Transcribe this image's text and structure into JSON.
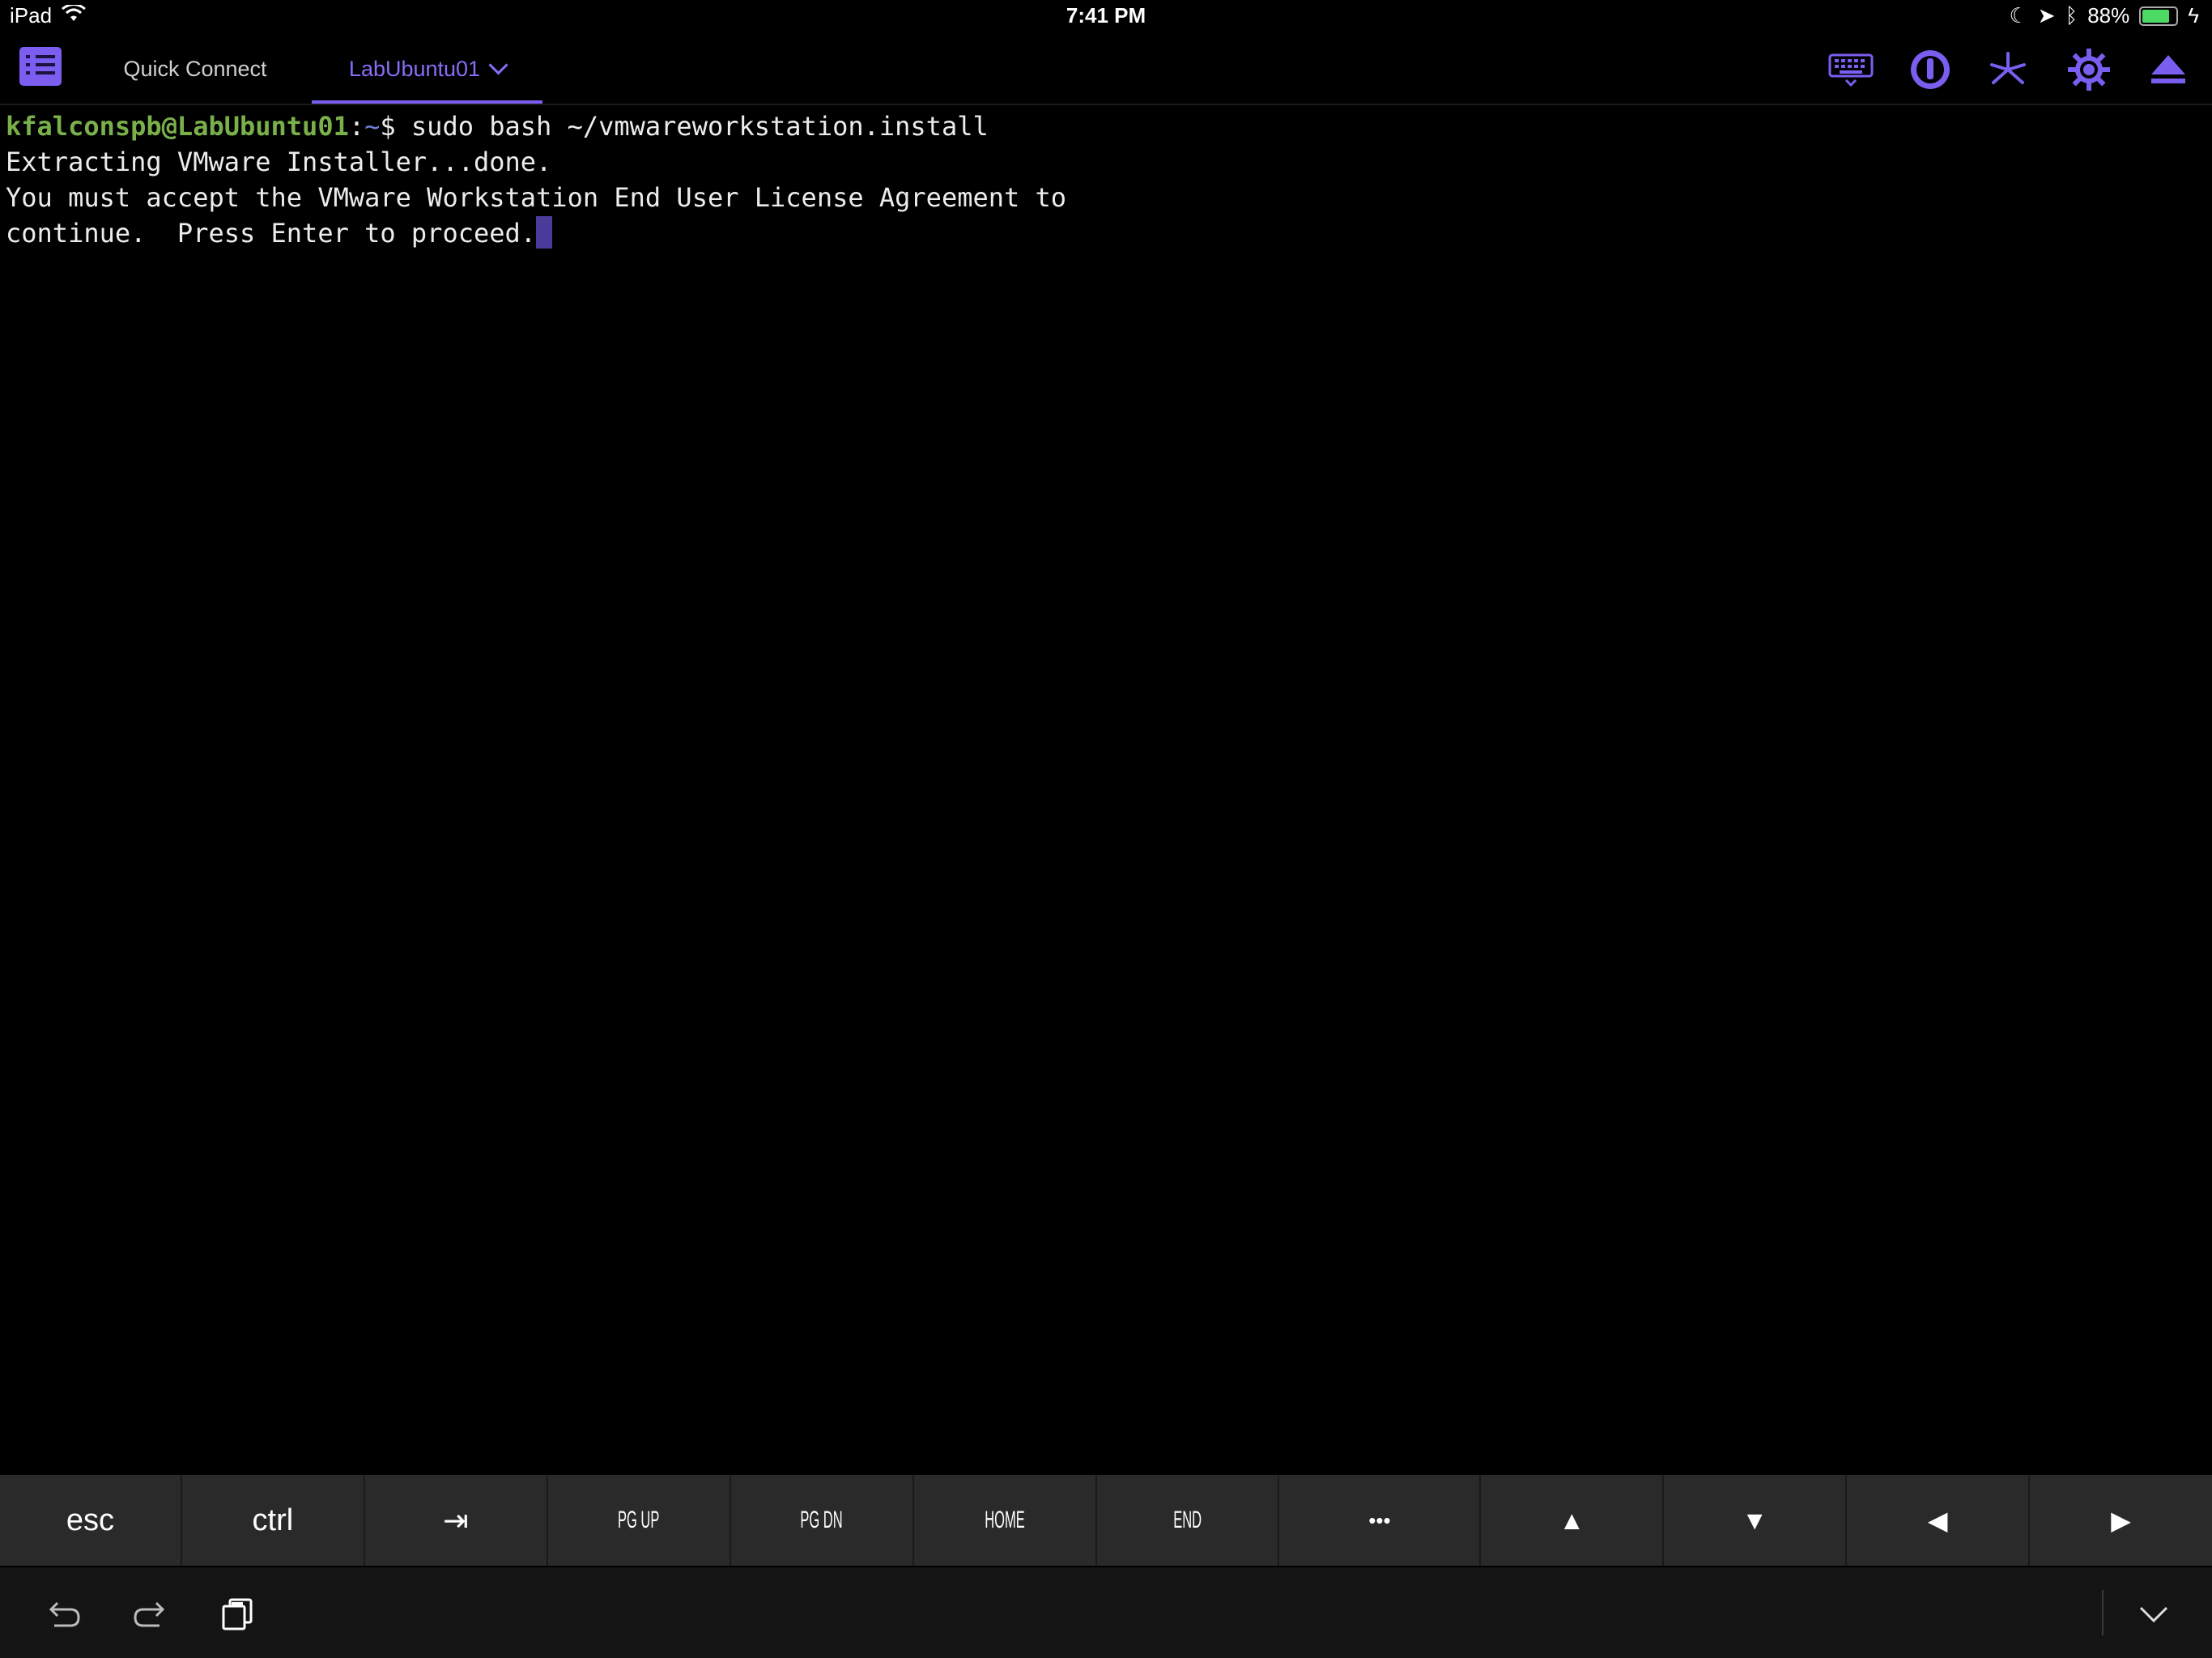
{
  "status_bar": {
    "device": "iPad",
    "time": "7:41 PM",
    "battery": "88%",
    "battery_level": 0.88
  },
  "tabs": {
    "quick_connect": "Quick Connect",
    "active": "LabUbuntu01"
  },
  "toolbar_icons": [
    "keyboard-icon",
    "info-key-icon",
    "asterisk-icon",
    "settings-gear-icon",
    "eject-icon"
  ],
  "terminal": {
    "prompt_user": "kfalconspb@LabUbuntu01",
    "prompt_sep": ":",
    "prompt_path": "~",
    "prompt_symbol": "$",
    "command": " sudo bash ~/vmwareworkstation.install",
    "lines": [
      "Extracting VMware Installer...done.",
      "You must accept the VMware Workstation End User License Agreement to",
      "continue.  Press Enter to proceed."
    ]
  },
  "keys": {
    "esc": "esc",
    "ctrl": "ctrl",
    "tab": "⇥",
    "pgup": "PG UP",
    "pgdn": "PG DN",
    "home": "HOME",
    "end": "END",
    "more": "•••",
    "up": "▲",
    "down": "▼",
    "left": "◀",
    "right": "▶"
  },
  "colors": {
    "accent": "#7b5ef0",
    "prompt_user": "#7ab04a",
    "prompt_path": "#6c7fd6",
    "background": "#000000"
  }
}
